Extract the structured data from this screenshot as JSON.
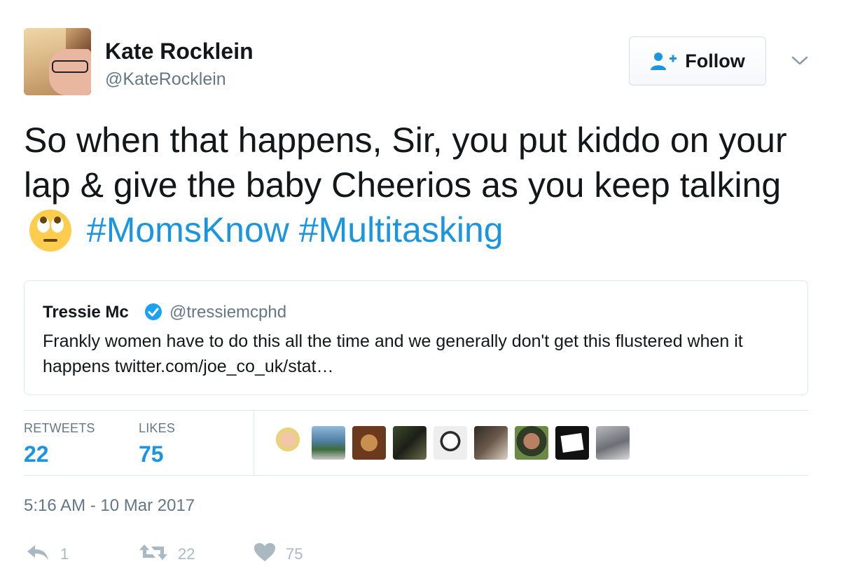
{
  "user": {
    "display_name": "Kate Rocklein",
    "handle": "@KateRocklein",
    "avatar_icon": "user-avatar-photo"
  },
  "follow": {
    "label": "Follow",
    "icon": "add-user-icon"
  },
  "menu": {
    "icon": "chevron-down-icon"
  },
  "tweet": {
    "text_part1": "So when that happens, Sir, you put kiddo on your lap & give the baby Cheerios as you keep talking",
    "emoji": "face-with-rolling-eyes",
    "hashtag1": "#MomsKnow",
    "hashtag2": "#Multitasking"
  },
  "quoted": {
    "name": "Tressie Mc",
    "verified_icon": "verified-badge-icon",
    "handle": "@tressiemcphd",
    "text": "Frankly women have to do this all the time and we generally don't get this flustered when it happens twitter.com/joe_co_uk/stat…"
  },
  "stats": {
    "retweets_label": "RETWEETS",
    "retweets_value": "22",
    "likes_label": "LIKES",
    "likes_value": "75"
  },
  "likers": [
    {
      "name": "liker-avatar-1"
    },
    {
      "name": "liker-avatar-2"
    },
    {
      "name": "liker-avatar-3"
    },
    {
      "name": "liker-avatar-4"
    },
    {
      "name": "liker-avatar-5"
    },
    {
      "name": "liker-avatar-6"
    },
    {
      "name": "liker-avatar-7"
    },
    {
      "name": "liker-avatar-8"
    },
    {
      "name": "liker-avatar-9"
    }
  ],
  "timestamp": "5:16 AM - 10 Mar 2017",
  "actions": {
    "reply_count": "1",
    "retweet_count": "22",
    "like_count": "75"
  },
  "colors": {
    "accent": "#1b95e0",
    "muted": "#657786",
    "action_gray": "#aab8c2",
    "border": "#e1e8ed"
  }
}
